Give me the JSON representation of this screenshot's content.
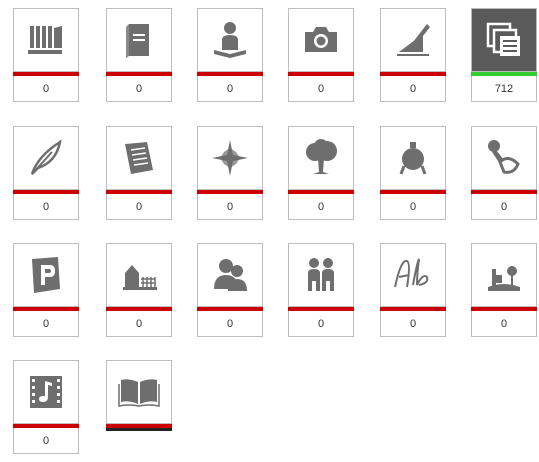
{
  "colors": {
    "icon": "#6e6e6e",
    "active_bg": "#5a5a5a",
    "bar_red": "#cc0000",
    "bar_green": "#33cc33"
  },
  "tiles": [
    {
      "icon": "archive-boxes-icon",
      "count": "0"
    },
    {
      "icon": "book-icon",
      "count": "0"
    },
    {
      "icon": "person-reading-icon",
      "count": "0"
    },
    {
      "icon": "camera-icon",
      "count": "0"
    },
    {
      "icon": "pen-signature-icon",
      "count": "0"
    },
    {
      "icon": "stacked-documents-icon",
      "count": "712",
      "active": true
    },
    {
      "icon": "feather-quill-icon",
      "count": "0"
    },
    {
      "icon": "scroll-document-icon",
      "count": "0"
    },
    {
      "icon": "compass-star-icon",
      "count": "0"
    },
    {
      "icon": "tree-icon",
      "count": "0"
    },
    {
      "icon": "bomb-ornament-icon",
      "count": "0"
    },
    {
      "icon": "stamp-icon",
      "count": "0"
    },
    {
      "icon": "parking-sign-icon",
      "count": "0"
    },
    {
      "icon": "house-fence-icon",
      "count": "0"
    },
    {
      "icon": "people-silhouette-icon",
      "count": "0"
    },
    {
      "icon": "family-icon",
      "count": "0"
    },
    {
      "icon": "handwriting-ab-icon",
      "count": "0"
    },
    {
      "icon": "landscape-icon",
      "count": "0"
    },
    {
      "icon": "film-music-icon",
      "count": "0"
    },
    {
      "icon": "open-book-icon",
      "count": ""
    }
  ]
}
